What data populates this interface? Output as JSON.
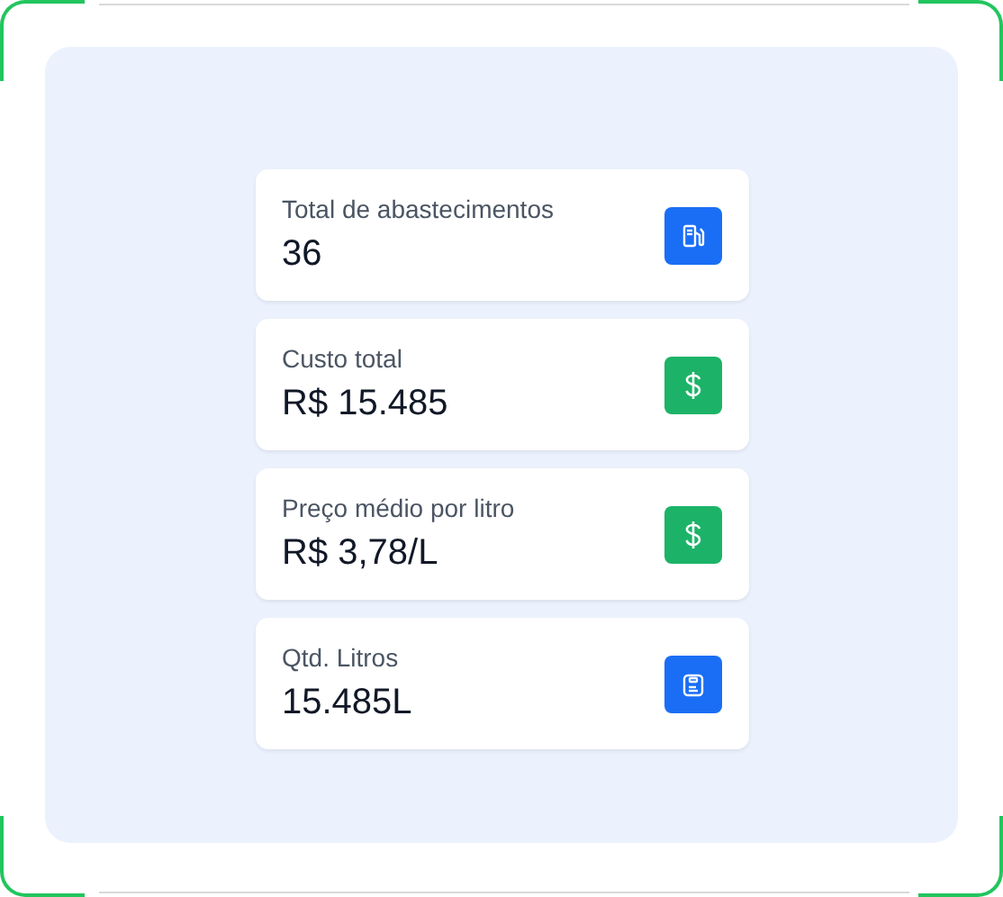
{
  "stats": [
    {
      "label": "Total de abastecimentos",
      "value": "36",
      "kind": "fuel",
      "color": "#1a6ef5"
    },
    {
      "label": "Custo total",
      "value": "R$ 15.485",
      "kind": "dollar",
      "color": "#1cb368"
    },
    {
      "label": "Preço médio por litro",
      "value": "R$ 3,78/L",
      "kind": "dollar",
      "color": "#1cb368"
    },
    {
      "label": "Qtd. Litros",
      "value": "15.485L",
      "kind": "tank",
      "color": "#1a6ef5"
    }
  ]
}
